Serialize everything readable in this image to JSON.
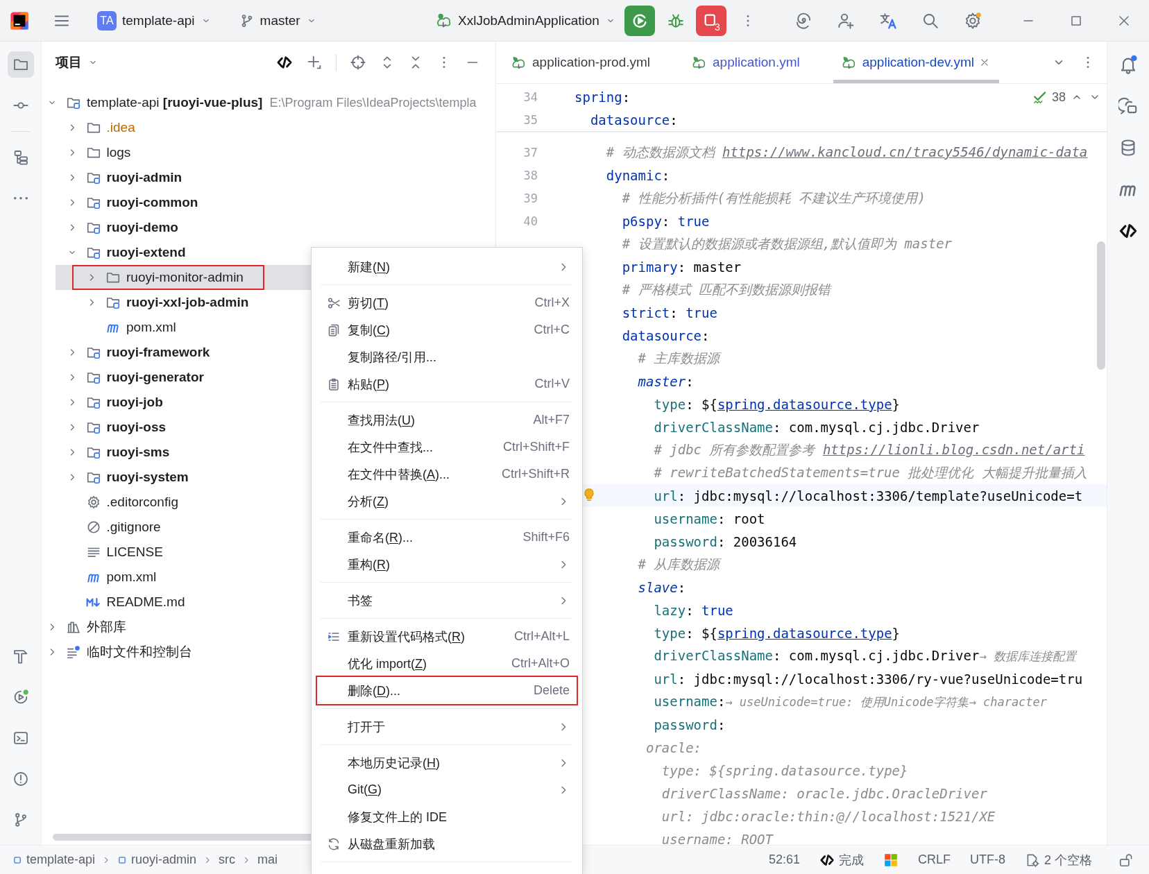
{
  "toolbar": {
    "project_badge": "TA",
    "project": "template-api",
    "branch": "master",
    "run_configuration": "XxlJobAdminApplication",
    "stop_badge": "3"
  },
  "left_toolbar": {
    "top": [
      {
        "kind": "project",
        "selected": true
      },
      {
        "kind": "commit",
        "selected": false
      },
      {
        "kind": "structure",
        "selected": false
      },
      {
        "kind": "more",
        "selected": false
      }
    ],
    "bottom": [
      {
        "kind": "build",
        "selected": false
      },
      {
        "kind": "run",
        "selected": false
      },
      {
        "kind": "terminal",
        "selected": false
      },
      {
        "kind": "problems",
        "selected": false
      },
      {
        "kind": "git",
        "selected": false
      }
    ]
  },
  "project_panel": {
    "title": "项目",
    "tree": [
      {
        "label": "template-api **[ruoyi-vue-plus]**",
        "path": "E:\\Program Files\\IdeaProjects\\templa",
        "kind": "project",
        "expanded": true,
        "selected": false,
        "marked": false,
        "children": [
          {
            "label": ".idea",
            "kind": "ignored-folder",
            "expanded": false,
            "selected": false,
            "marked": false
          },
          {
            "label": "logs",
            "kind": "folder",
            "expanded": false,
            "selected": false,
            "marked": false
          },
          {
            "label": "ruoyi-admin",
            "kind": "module",
            "expanded": false,
            "selected": false,
            "marked": false
          },
          {
            "label": "ruoyi-common",
            "kind": "module",
            "expanded": false,
            "selected": false,
            "marked": false
          },
          {
            "label": "ruoyi-demo",
            "kind": "module",
            "expanded": false,
            "selected": false,
            "marked": false
          },
          {
            "label": "ruoyi-extend",
            "kind": "module",
            "expanded": true,
            "selected": false,
            "marked": false,
            "children": [
              {
                "label": "ruoyi-monitor-admin",
                "kind": "folder",
                "expanded": false,
                "selected": true,
                "marked": true
              },
              {
                "label": "ruoyi-xxl-job-admin",
                "kind": "module",
                "expanded": false,
                "selected": false,
                "marked": false
              },
              {
                "label": "pom.xml",
                "kind": "maven",
                "selected": false,
                "marked": false
              }
            ]
          },
          {
            "label": "ruoyi-framework",
            "kind": "module",
            "expanded": false,
            "selected": false,
            "marked": false
          },
          {
            "label": "ruoyi-generator",
            "kind": "module",
            "expanded": false,
            "selected": false,
            "marked": false
          },
          {
            "label": "ruoyi-job",
            "kind": "module",
            "expanded": false,
            "selected": false,
            "marked": false
          },
          {
            "label": "ruoyi-oss",
            "kind": "module",
            "expanded": false,
            "selected": false,
            "marked": false
          },
          {
            "label": "ruoyi-sms",
            "kind": "module",
            "expanded": false,
            "selected": false,
            "marked": false
          },
          {
            "label": "ruoyi-system",
            "kind": "module",
            "expanded": false,
            "selected": false,
            "marked": false
          },
          {
            "label": ".editorconfig",
            "kind": "config",
            "selected": false,
            "marked": false
          },
          {
            "label": ".gitignore",
            "kind": "ignore",
            "selected": false,
            "marked": false
          },
          {
            "label": "LICENSE",
            "kind": "text",
            "selected": false,
            "marked": false
          },
          {
            "label": "pom.xml",
            "kind": "maven",
            "selected": false,
            "marked": false
          },
          {
            "label": "README.md",
            "kind": "markdown",
            "selected": false,
            "marked": false
          }
        ]
      },
      {
        "label": "外部库",
        "kind": "library",
        "expanded": false,
        "selected": false,
        "marked": false
      },
      {
        "label": "临时文件和控制台",
        "kind": "scratch",
        "expanded": false,
        "selected": false,
        "marked": false
      }
    ]
  },
  "tabs": [
    {
      "label": "application-prod.yml",
      "selected": false,
      "color": "#3b3d45"
    },
    {
      "label": "application.yml",
      "selected": false,
      "color": "#4456c8"
    },
    {
      "label": "application-dev.yml",
      "selected": true,
      "color": "#1948bf"
    }
  ],
  "editor": {
    "inspection_count": "38",
    "sticky": [
      {
        "number": "34",
        "tokens": [
          {
            "kind": "key",
            "text": "spring"
          },
          {
            "kind": "plain",
            "text": ":"
          }
        ]
      },
      {
        "number": "35",
        "tokens": [
          {
            "kind": "key",
            "text": "  datasource"
          },
          {
            "kind": "plain",
            "text": ":"
          }
        ]
      }
    ],
    "lines": [
      {
        "number": "37",
        "current": false,
        "tokens": [
          {
            "kind": "comment",
            "text": "    # 动态数据源文档 "
          },
          {
            "kind": "comment-link",
            "text": "https://www.kancloud.cn/tracy5546/dynamic-data"
          }
        ]
      },
      {
        "number": "38",
        "current": false,
        "tokens": [
          {
            "kind": "key",
            "text": "    dynamic"
          },
          {
            "kind": "plain",
            "text": ":"
          }
        ]
      },
      {
        "number": "39",
        "current": false,
        "tokens": [
          {
            "kind": "comment",
            "text": "      # 性能分析插件(有性能损耗 不建议生产环境使用)"
          }
        ]
      },
      {
        "number": "40",
        "current": false,
        "tokens": [
          {
            "kind": "key",
            "text": "      p6spy"
          },
          {
            "kind": "plain",
            "text": ": "
          },
          {
            "kind": "keyword",
            "text": "true"
          }
        ]
      },
      {
        "current": false,
        "tokens": [
          {
            "kind": "comment",
            "text": "      # 设置默认的数据源或者数据源组,默认值即为 master"
          }
        ]
      },
      {
        "current": false,
        "tokens": [
          {
            "kind": "key",
            "text": "      primary"
          },
          {
            "kind": "plain",
            "text": ": master"
          }
        ]
      },
      {
        "current": false,
        "tokens": [
          {
            "kind": "comment",
            "text": "      # 严格模式 匹配不到数据源则报错"
          }
        ]
      },
      {
        "current": false,
        "tokens": [
          {
            "kind": "key",
            "text": "      strict"
          },
          {
            "kind": "plain",
            "text": ": "
          },
          {
            "kind": "keyword",
            "text": "true"
          }
        ]
      },
      {
        "current": false,
        "tokens": [
          {
            "kind": "key",
            "text": "      datasource"
          },
          {
            "kind": "plain",
            "text": ":"
          }
        ]
      },
      {
        "current": false,
        "tokens": [
          {
            "kind": "comment",
            "text": "        # 主库数据源"
          }
        ]
      },
      {
        "current": false,
        "tokens": [
          {
            "kind": "anchor-key",
            "text": "        master"
          },
          {
            "kind": "plain",
            "text": ":"
          }
        ]
      },
      {
        "current": false,
        "tokens": [
          {
            "kind": "property",
            "text": "          type"
          },
          {
            "kind": "plain",
            "text": ": ${"
          },
          {
            "kind": "link",
            "text": "spring.datasource.type"
          },
          {
            "kind": "plain",
            "text": "}"
          }
        ]
      },
      {
        "current": false,
        "tokens": [
          {
            "kind": "property",
            "text": "          driverClassName"
          },
          {
            "kind": "plain",
            "text": ": com.mysql.cj.jdbc.Driver"
          }
        ]
      },
      {
        "current": false,
        "tokens": [
          {
            "kind": "comment",
            "text": "          # jdbc 所有参数配置参考 "
          },
          {
            "kind": "comment-link",
            "text": "https://lionli.blog.csdn.net/arti"
          }
        ]
      },
      {
        "current": false,
        "tokens": [
          {
            "kind": "comment",
            "text": "          # rewriteBatchedStatements=true 批处理优化 大幅提升批量插入"
          }
        ]
      },
      {
        "current": true,
        "tokens": [
          {
            "kind": "property",
            "text": "          url"
          },
          {
            "kind": "plain",
            "text": ": jdbc:mysql://localhost:3306/template?useUnicode=t"
          }
        ]
      },
      {
        "current": false,
        "tokens": [
          {
            "kind": "property",
            "text": "          username"
          },
          {
            "kind": "plain",
            "text": ": root"
          }
        ]
      },
      {
        "current": false,
        "tokens": [
          {
            "kind": "property",
            "text": "          password"
          },
          {
            "kind": "plain",
            "text": ": 20036164"
          }
        ]
      },
      {
        "current": false,
        "tokens": [
          {
            "kind": "comment",
            "text": "        # 从库数据源"
          }
        ]
      },
      {
        "current": false,
        "tokens": [
          {
            "kind": "anchor-key",
            "text": "        slave"
          },
          {
            "kind": "plain",
            "text": ":"
          }
        ]
      },
      {
        "current": false,
        "tokens": [
          {
            "kind": "property",
            "text": "          lazy"
          },
          {
            "kind": "plain",
            "text": ": "
          },
          {
            "kind": "keyword",
            "text": "true"
          }
        ]
      },
      {
        "current": false,
        "tokens": [
          {
            "kind": "property",
            "text": "          type"
          },
          {
            "kind": "plain",
            "text": ": ${"
          },
          {
            "kind": "link",
            "text": "spring.datasource.type"
          },
          {
            "kind": "plain",
            "text": "}"
          }
        ]
      },
      {
        "current": false,
        "tokens": [
          {
            "kind": "property",
            "text": "          driverClassName"
          },
          {
            "kind": "plain",
            "text": ": com.mysql.cj.jdbc.Driver"
          },
          {
            "kind": "hint",
            "text": "→ 数据库连接配置"
          }
        ]
      },
      {
        "current": false,
        "tokens": [
          {
            "kind": "property",
            "text": "          url"
          },
          {
            "kind": "plain",
            "text": ": jdbc:mysql://localhost:3306/ry-vue?useUnicode=tru"
          }
        ]
      },
      {
        "current": false,
        "tokens": [
          {
            "kind": "property",
            "text": "          username"
          },
          {
            "kind": "plain",
            "text": ":"
          },
          {
            "kind": "hint",
            "text": "→ useUnicode=true: 使用Unicode字符集→ character"
          }
        ]
      },
      {
        "current": false,
        "tokens": [
          {
            "kind": "property",
            "text": "          password"
          },
          {
            "kind": "plain",
            "text": ":"
          }
        ]
      },
      {
        "current": false,
        "tokens": [
          {
            "kind": "inactive",
            "text": "         oracle:"
          }
        ]
      },
      {
        "current": false,
        "tokens": [
          {
            "kind": "inactive",
            "text": "           type: ${spring.datasource.type}"
          }
        ]
      },
      {
        "current": false,
        "tokens": [
          {
            "kind": "inactive",
            "text": "           driverClassName: oracle.jdbc.OracleDriver"
          }
        ]
      },
      {
        "current": false,
        "tokens": [
          {
            "kind": "inactive",
            "text": "           url: jdbc:oracle:thin:@//localhost:1521/XE"
          }
        ]
      },
      {
        "current": false,
        "tokens": [
          {
            "kind": "inactive",
            "text": "           username: ROOT"
          }
        ]
      }
    ]
  },
  "right_toolbar": [
    {
      "kind": "notifications"
    },
    {
      "kind": "ai-chat"
    },
    {
      "kind": "database"
    },
    {
      "kind": "maven"
    },
    {
      "kind": "code-with-me"
    }
  ],
  "context_menu": {
    "groups": [
      [
        {
          "label": "新建(N)",
          "kind": "plain",
          "submenu": true,
          "marked": false
        }
      ],
      [
        {
          "label": "剪切(T)",
          "kind": "cut",
          "shortcut": "Ctrl+X",
          "submenu": false,
          "marked": false
        },
        {
          "label": "复制(C)",
          "kind": "copy",
          "shortcut": "Ctrl+C",
          "submenu": false,
          "marked": false
        },
        {
          "label": "复制路径/引用...",
          "kind": "plain",
          "submenu": false,
          "marked": false
        },
        {
          "label": "粘贴(P)",
          "kind": "paste",
          "shortcut": "Ctrl+V",
          "submenu": false,
          "marked": false
        }
      ],
      [
        {
          "label": "查找用法(U)",
          "kind": "plain",
          "shortcut": "Alt+F7",
          "submenu": false,
          "marked": false
        },
        {
          "label": "在文件中查找...",
          "kind": "plain",
          "shortcut": "Ctrl+Shift+F",
          "submenu": false,
          "marked": false
        },
        {
          "label": "在文件中替换(A)...",
          "kind": "plain",
          "shortcut": "Ctrl+Shift+R",
          "submenu": false,
          "marked": false
        },
        {
          "label": "分析(Z)",
          "kind": "plain",
          "submenu": true,
          "marked": false
        }
      ],
      [
        {
          "label": "重命名(R)...",
          "kind": "plain",
          "shortcut": "Shift+F6",
          "submenu": false,
          "marked": false
        },
        {
          "label": "重构(R)",
          "kind": "plain",
          "submenu": true,
          "marked": false
        }
      ],
      [
        {
          "label": "书签",
          "kind": "plain",
          "submenu": true,
          "marked": false
        }
      ],
      [
        {
          "label": "重新设置代码格式(R)",
          "kind": "reformat",
          "shortcut": "Ctrl+Alt+L",
          "submenu": false,
          "marked": false
        },
        {
          "label": "优化 import(Z)",
          "kind": "plain",
          "shortcut": "Ctrl+Alt+O",
          "submenu": false,
          "marked": false
        },
        {
          "label": "删除(D)...",
          "kind": "plain",
          "shortcut": "Delete",
          "submenu": false,
          "marked": true
        }
      ],
      [
        {
          "label": "打开于",
          "kind": "plain",
          "submenu": true,
          "marked": false
        }
      ],
      [
        {
          "label": "本地历史记录(H)",
          "kind": "plain",
          "submenu": true,
          "marked": false
        },
        {
          "label": "Git(G)",
          "kind": "plain",
          "submenu": true,
          "marked": false
        },
        {
          "label": "修复文件上的 IDE",
          "kind": "plain",
          "submenu": false,
          "marked": false
        },
        {
          "label": "从磁盘重新加载",
          "kind": "reload",
          "submenu": false,
          "marked": false
        }
      ]
    ]
  },
  "status_bar": {
    "breadcrumbs": [
      {
        "label": "template-api",
        "kind": "module"
      },
      {
        "label": "ruoyi-admin",
        "kind": "module"
      },
      {
        "label": "src",
        "kind": "plain"
      },
      {
        "label": "mai",
        "kind": "plain"
      }
    ],
    "position": "52:61",
    "assistant": "完成",
    "line_separator": "CRLF",
    "encoding": "UTF-8",
    "indent": "2 个空格"
  }
}
